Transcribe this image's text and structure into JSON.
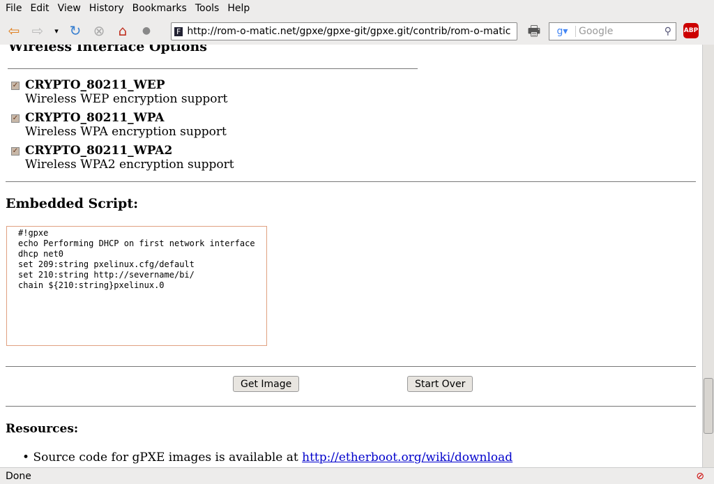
{
  "menu": [
    "File",
    "Edit",
    "View",
    "History",
    "Bookmarks",
    "Tools",
    "Help"
  ],
  "url": "http://rom-o-matic.net/gpxe/gpxe-git/gpxe.git/contrib/rom-o-matic",
  "search_placeholder": "Google",
  "section_title": "Wireless Interface Options",
  "options": [
    {
      "name": "CRYPTO_80211_WEP",
      "desc": "Wireless WEP encryption support",
      "checked": true
    },
    {
      "name": "CRYPTO_80211_WPA",
      "desc": "Wireless WPA encryption support",
      "checked": true
    },
    {
      "name": "CRYPTO_80211_WPA2",
      "desc": "Wireless WPA2 encryption support",
      "checked": true
    }
  ],
  "script_title": "Embedded Script:",
  "script": "#!gpxe\necho Performing DHCP on first network interface\ndhcp net0\nset 209:string pxelinux.cfg/default\nset 210:string http://severname/bi/\nchain ${210:string}pxelinux.0",
  "buttons": {
    "get_image": "Get Image",
    "start_over": "Start Over"
  },
  "resources_title": "Resources:",
  "resource_text": "Source code for gPXE images is available at ",
  "resource_link": "http://etherboot.org/wiki/download",
  "status": "Done"
}
